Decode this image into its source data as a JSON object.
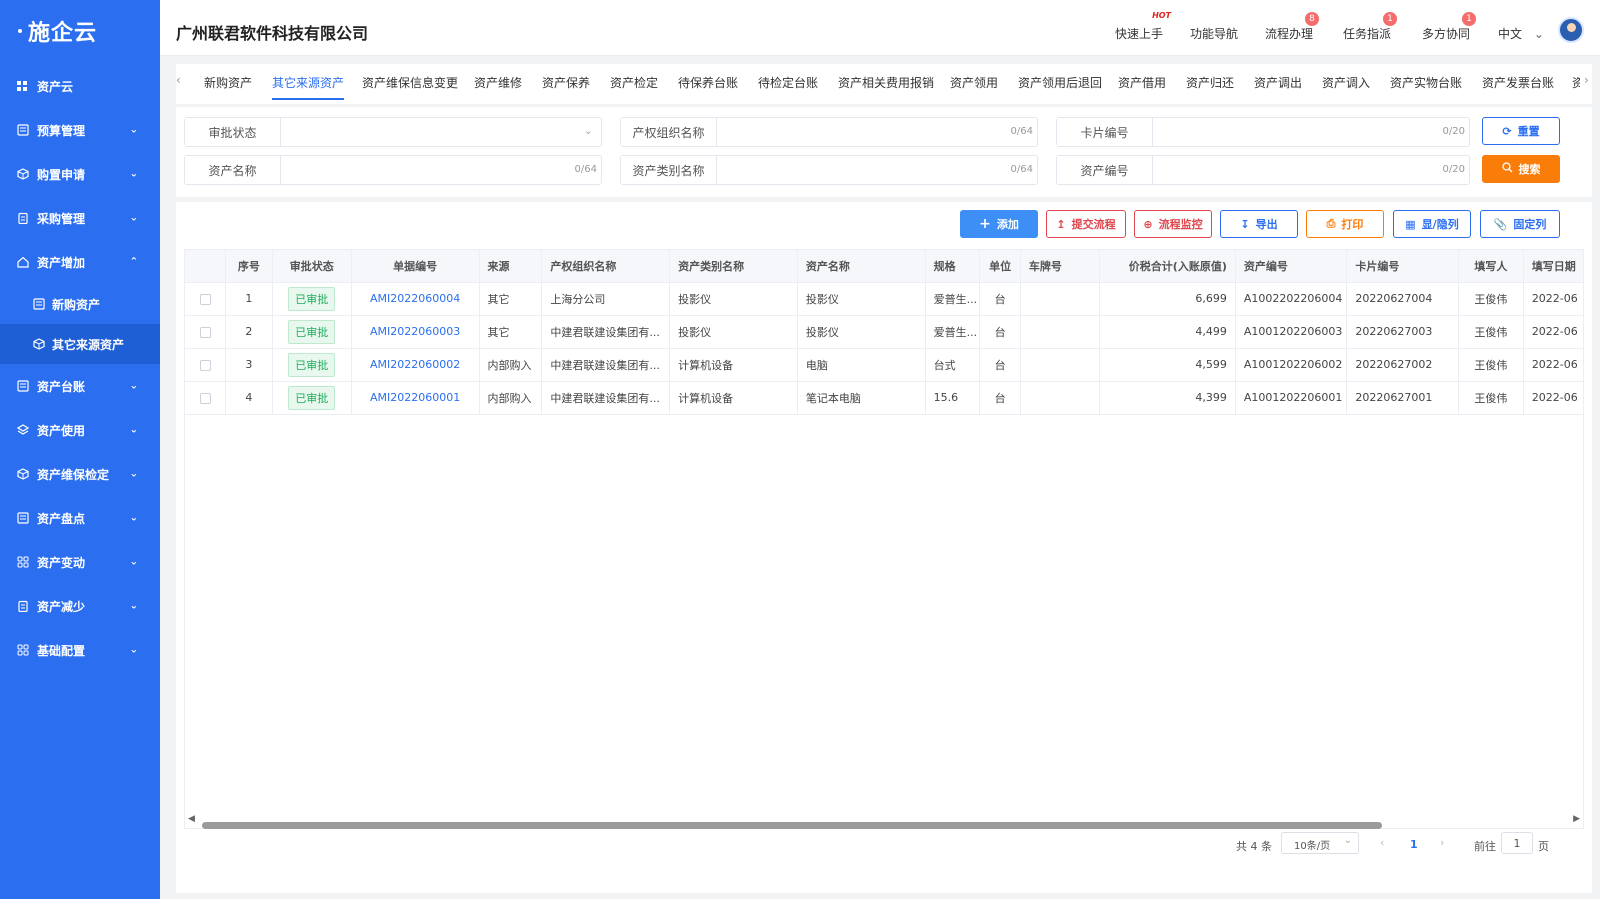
{
  "app": {
    "logo": "施企云",
    "company": "广州联君软件科技有限公司"
  },
  "header": {
    "quick_start": "快速上手",
    "quick_start_tag": "HOT",
    "feature_nav": "功能导航",
    "process": "流程办理",
    "process_badge": "8",
    "task": "任务指派",
    "task_badge": "1",
    "collab": "多方协同",
    "collab_badge": "1",
    "lang": "中文"
  },
  "sidebar": {
    "top": "资产云",
    "items": [
      "预算管理",
      "购置申请",
      "采购管理",
      "资产增加",
      "资产台账",
      "资产使用",
      "资产维保检定",
      "资产盘点",
      "资产变动",
      "资产减少",
      "基础配置"
    ],
    "subitems": [
      "新购资产",
      "其它来源资产"
    ]
  },
  "tabs": [
    "新购资产",
    "其它来源资产",
    "资产维保信息变更",
    "资产维修",
    "资产保养",
    "资产检定",
    "待保养台账",
    "待检定台账",
    "资产相关费用报销",
    "资产领用",
    "资产领用后退回",
    "资产借用",
    "资产归还",
    "资产调出",
    "资产调入",
    "资产实物台账",
    "资产发票台账",
    "资"
  ],
  "filters": {
    "status_label": "审批状态",
    "org_label": "产权组织名称",
    "org_count": "0/64",
    "card_label": "卡片编号",
    "card_count": "0/20",
    "name_label": "资产名称",
    "name_count": "0/64",
    "category_label": "资产类别名称",
    "category_count": "0/64",
    "code_label": "资产编号",
    "code_count": "0/20",
    "reset": "重置",
    "search": "搜索"
  },
  "toolbar": {
    "add": "添加",
    "submit": "提交流程",
    "monitor": "流程监控",
    "export": "导出",
    "print": "打印",
    "columns": "显/隐列",
    "fix": "固定列"
  },
  "table": {
    "headers": [
      "序号",
      "审批状态",
      "单据编号",
      "来源",
      "产权组织名称",
      "资产类别名称",
      "资产名称",
      "规格",
      "单位",
      "车牌号",
      "价税合计(入账原值)",
      "资产编号",
      "卡片编号",
      "填写人",
      "填写日期"
    ],
    "rows": [
      {
        "no": "1",
        "status": "已审批",
        "doc": "AMI2022060004",
        "source": "其它",
        "org": "上海分公司",
        "category": "投影仪",
        "name": "投影仪",
        "spec": "爱普生...",
        "unit": "台",
        "plate": "",
        "price": "6,699",
        "asset_code": "A1002202206004",
        "card": "20220627004",
        "filler": "王俊伟",
        "date": "2022-06"
      },
      {
        "no": "2",
        "status": "已审批",
        "doc": "AMI2022060003",
        "source": "其它",
        "org": "中建君联建设集团有...",
        "category": "投影仪",
        "name": "投影仪",
        "spec": "爱普生...",
        "unit": "台",
        "plate": "",
        "price": "4,499",
        "asset_code": "A1001202206003",
        "card": "20220627003",
        "filler": "王俊伟",
        "date": "2022-06"
      },
      {
        "no": "3",
        "status": "已审批",
        "doc": "AMI2022060002",
        "source": "内部购入",
        "org": "中建君联建设集团有...",
        "category": "计算机设备",
        "name": "电脑",
        "spec": "台式",
        "unit": "台",
        "plate": "",
        "price": "4,599",
        "asset_code": "A1001202206002",
        "card": "20220627002",
        "filler": "王俊伟",
        "date": "2022-06"
      },
      {
        "no": "4",
        "status": "已审批",
        "doc": "AMI2022060001",
        "source": "内部购入",
        "org": "中建君联建设集团有...",
        "category": "计算机设备",
        "name": "笔记本电脑",
        "spec": "15.6",
        "unit": "台",
        "plate": "",
        "price": "4,399",
        "asset_code": "A1001202206001",
        "card": "20220627001",
        "filler": "王俊伟",
        "date": "2022-06"
      }
    ]
  },
  "pagination": {
    "total": "共 4 条",
    "page_size": "10条/页",
    "current": "1",
    "goto_prefix": "前往",
    "goto_value": "1",
    "goto_suffix": "页"
  },
  "colors": {
    "primary": "#2b6ff0",
    "orange": "#fa7d0a",
    "danger": "#e0484f",
    "success": "#1eae5c"
  }
}
